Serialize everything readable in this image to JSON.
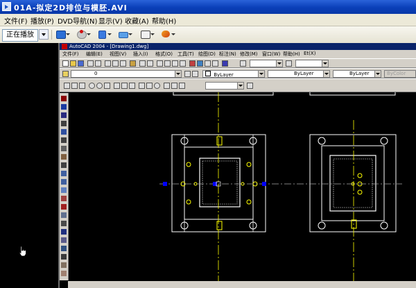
{
  "player": {
    "title": "01A-拟定2D排位与模胚.AVI",
    "menu": [
      "文件(F)",
      "播放(P)",
      "DVD导航(N)",
      "显示(V)",
      "收藏(A)",
      "帮助(H)"
    ],
    "now_playing_label": "正在播放"
  },
  "cad": {
    "title": "AutoCAD 2004 - [Drawing1.dwg]",
    "menu": [
      "文件(F)",
      "编辑(E)",
      "视图(V)",
      "插入(I)",
      "格式(O)",
      "工具(T)",
      "绘图(D)",
      "标注(N)",
      "修改(M)",
      "窗口(W)",
      "帮助(H)",
      "Et(X)"
    ],
    "layer_value": "0",
    "color_value": "ByLayer",
    "linetype_value": "ByLayer",
    "lineweight_value": "ByLayer",
    "plotstyle_value": "ByColor"
  },
  "colors": {
    "player_title": "#0a3fb8",
    "xp_face": "#ece9d8",
    "cad_face": "#d4d0c8",
    "canvas": "#000000",
    "drawing_white": "#ffffff",
    "drawing_yellow": "#ffff00",
    "grip_blue": "#0000ff"
  }
}
